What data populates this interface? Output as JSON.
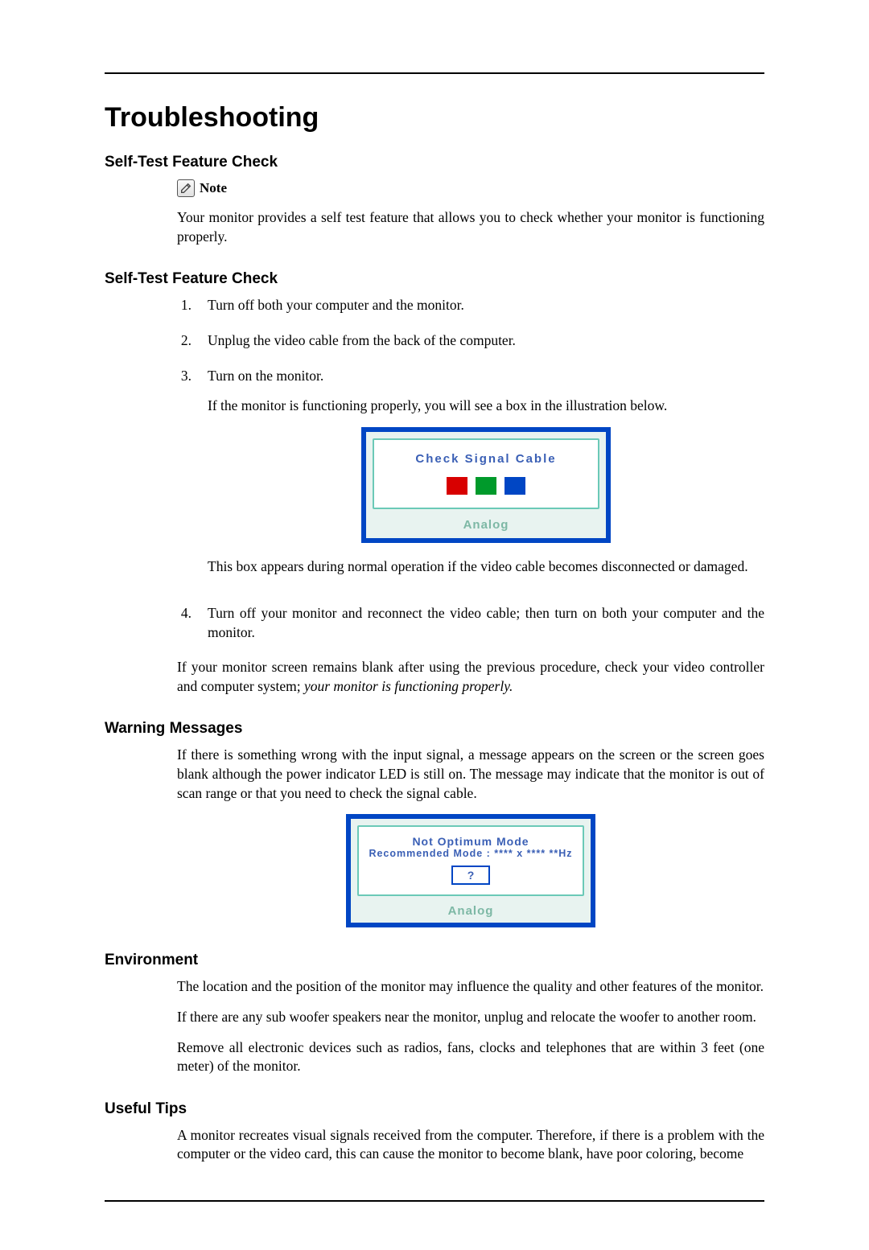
{
  "title": "Troubleshooting",
  "sections": {
    "selftest1": {
      "heading": "Self-Test Feature Check",
      "note_label": "Note",
      "note_body": "Your monitor provides a self test feature that allows you to check whether your monitor is functioning properly."
    },
    "selftest2": {
      "heading": "Self-Test Feature Check",
      "items": {
        "i1": {
          "num": "1.",
          "text": "Turn off both your computer and the monitor."
        },
        "i2": {
          "num": "2.",
          "text": "Unplug the video cable from the back of the computer."
        },
        "i3": {
          "num": "3.",
          "text1": "Turn on the monitor.",
          "text2": "If the monitor is functioning properly, you will see a box in the illustration below.",
          "after_box": "This box appears during normal operation if the video cable becomes disconnected or damaged."
        },
        "i4": {
          "num": "4.",
          "text": "Turn off your monitor and reconnect the video cable; then turn on both your computer and the monitor."
        }
      },
      "closing_a": "If your monitor screen remains blank after using the previous procedure, check your video controller and computer system; ",
      "closing_b_italic": "your monitor is functioning properly.",
      "box1": {
        "title": "Check Signal Cable",
        "footer": "Analog"
      }
    },
    "warning": {
      "heading": "Warning Messages",
      "body": "If there is something wrong with the input signal, a message appears on the screen or the screen goes blank although the power indicator LED is still on. The message may indicate that the monitor is out of scan range or that you need to check the signal cable.",
      "box": {
        "line1": "Not Optimum Mode",
        "line2": "Recommended Mode :  **** x ****   **Hz",
        "q": "?",
        "footer": "Analog"
      }
    },
    "environment": {
      "heading": "Environment",
      "p1": "The location and the position of the monitor may influence the quality and other features of the monitor.",
      "p2": "If there are any sub woofer speakers near the monitor, unplug and relocate the woofer to another room.",
      "p3": "Remove all electronic devices such as radios, fans, clocks and telephones that are within 3 feet (one meter) of the monitor."
    },
    "tips": {
      "heading": "Useful Tips",
      "p1": "A monitor recreates visual signals received from the computer. Therefore, if there is a problem with the computer or the video card, this can cause the monitor to become blank, have poor coloring, become"
    }
  }
}
